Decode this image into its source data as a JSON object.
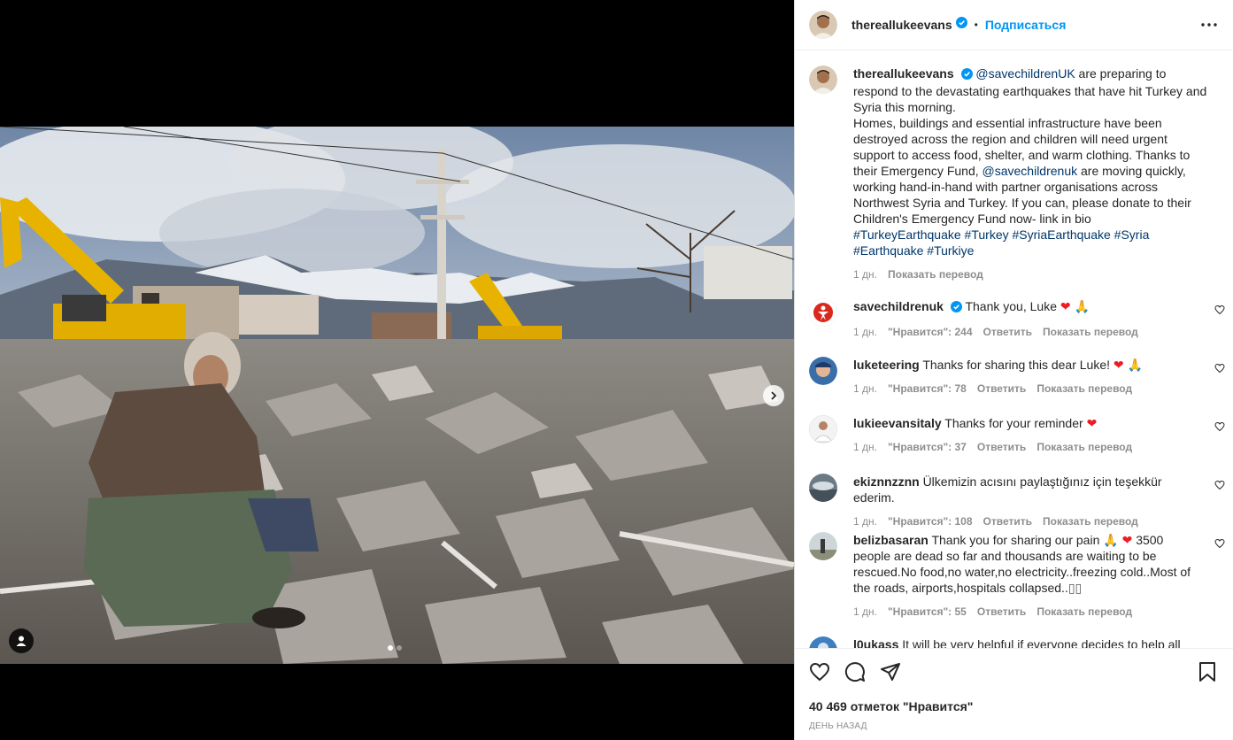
{
  "post": {
    "username": "thereallukeevans",
    "follow_label": "Подписаться",
    "separator": "•"
  },
  "caption": {
    "username": "thereallukeevans",
    "mention1": "@savechildrenUK",
    "text1": " are preparing to respond to the devastating earthquakes that have hit Turkey and Syria this morning.",
    "text2": "Homes, buildings and essential infrastructure have been destroyed across the region and children will need urgent support to access food, shelter, and warm clothing. Thanks to their Emergency Fund, ",
    "mention2": "@savechildrenuk",
    "text3": " are moving quickly, working hand-in-hand with partner organisations across Northwest Syria and Turkey. If you can, please donate to their Children's Emergency Fund now- link in bio",
    "hashtags": "#TurkeyEarthquake #Turkey #SyriaEarthquake #Syria #Earthquake #Turkiye",
    "time": "1 дн.",
    "translate": "Показать перевод"
  },
  "comments": [
    {
      "username": "savechildrenuk",
      "text": "Thank you, Luke",
      "time": "1 дн.",
      "likes": "\"Нравится\": 244",
      "reply": "Ответить",
      "translate": "Показать перевод"
    },
    {
      "username": "luketeering",
      "text": "Thanks for sharing this dear Luke!",
      "time": "1 дн.",
      "likes": "\"Нравится\": 78",
      "reply": "Ответить",
      "translate": "Показать перевод"
    },
    {
      "username": "lukieevansitaly",
      "text": "Thanks for your reminder",
      "time": "1 дн.",
      "likes": "\"Нравится\": 37",
      "reply": "Ответить",
      "translate": "Показать перевод"
    },
    {
      "username": "ekiznnzznn",
      "text": "Ülkemizin acısını paylaştığınız için teşekkür ederim.",
      "time": "1 дн.",
      "likes": "\"Нравится\": 108",
      "reply": "Ответить",
      "translate": "Показать перевод"
    },
    {
      "username": "belizbasaran",
      "text_a": "Thank you for sharing our pain",
      "text_b": " 3500 people are dead so far and thousands are waiting to be rescued.No food,no water,no electricity..freezing cold..Most of the roads, airports,hospitals collapsed..",
      "time": "1 дн.",
      "likes": "\"Нравится\": 55",
      "reply": "Ответить",
      "translate": "Показать перевод"
    },
    {
      "username": "l0ukass",
      "text": "It will be very helpful if everyone decides to help all"
    }
  ],
  "footer": {
    "likes_count": "40 469 отметок \"Нравится\"",
    "time_ago": "ДЕНЬ НАЗАД"
  },
  "icons": {
    "verified": "verified-badge-icon",
    "more": "more-horizontal-icon",
    "like": "heart-outline-icon",
    "comment": "comment-icon",
    "share": "paper-plane-icon",
    "save": "bookmark-icon",
    "next": "chevron-right-icon",
    "tag": "user-tag-icon"
  },
  "colors": {
    "link_blue": "#0095f6",
    "mention": "#00376b",
    "muted": "#8e8e8e",
    "heart": "#ed1c24"
  }
}
